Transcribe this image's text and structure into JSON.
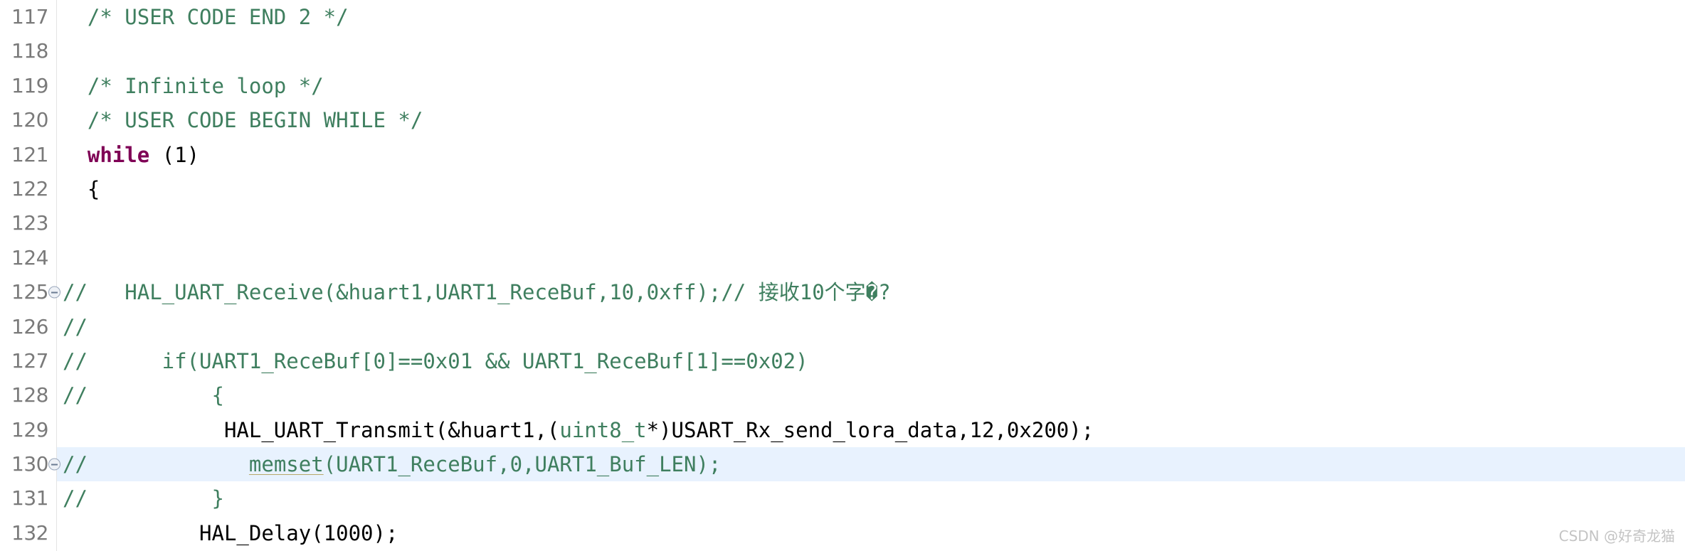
{
  "editor": {
    "app": "c-code-editor",
    "gutter_color": "#7a7a7a",
    "current_line_color": "#e8f2fe",
    "comment_color": "#3f7f5f",
    "keyword_color": "#7f0055",
    "text_color": "#000000",
    "background_color": "#ffffff"
  },
  "watermark": {
    "text": "CSDN @好奇龙猫"
  },
  "lines": [
    {
      "number": "117",
      "fold": false,
      "current": false,
      "tokens": [
        {
          "cls": "cmt",
          "text": "  /* USER CODE END 2 */"
        }
      ]
    },
    {
      "number": "118",
      "fold": false,
      "current": false,
      "tokens": [
        {
          "cls": "plain",
          "text": ""
        }
      ]
    },
    {
      "number": "119",
      "fold": false,
      "current": false,
      "tokens": [
        {
          "cls": "cmt",
          "text": "  /* Infinite loop */"
        }
      ]
    },
    {
      "number": "120",
      "fold": false,
      "current": false,
      "tokens": [
        {
          "cls": "cmt",
          "text": "  /* USER CODE BEGIN WHILE */"
        }
      ]
    },
    {
      "number": "121",
      "fold": false,
      "current": false,
      "tokens": [
        {
          "cls": "plain",
          "text": "  "
        },
        {
          "cls": "kw",
          "text": "while"
        },
        {
          "cls": "plain",
          "text": " (1)"
        }
      ]
    },
    {
      "number": "122",
      "fold": false,
      "current": false,
      "tokens": [
        {
          "cls": "plain",
          "text": "  {"
        }
      ]
    },
    {
      "number": "123",
      "fold": false,
      "current": false,
      "tokens": [
        {
          "cls": "plain",
          "text": ""
        }
      ]
    },
    {
      "number": "124",
      "fold": false,
      "current": false,
      "tokens": [
        {
          "cls": "plain",
          "text": ""
        }
      ]
    },
    {
      "number": "125",
      "fold": true,
      "current": false,
      "tokens": [
        {
          "cls": "cmt",
          "text": "//   HAL_UART_Receive(&huart1,UART1_ReceBuf,10,0xff);// 接收10个字�?"
        }
      ]
    },
    {
      "number": "126",
      "fold": false,
      "current": false,
      "tokens": [
        {
          "cls": "cmt",
          "text": "//"
        }
      ]
    },
    {
      "number": "127",
      "fold": false,
      "current": false,
      "tokens": [
        {
          "cls": "cmt",
          "text": "//      if(UART1_ReceBuf[0]==0x01 && UART1_ReceBuf[1]==0x02)"
        }
      ]
    },
    {
      "number": "128",
      "fold": false,
      "current": false,
      "tokens": [
        {
          "cls": "cmt",
          "text": "//          {"
        }
      ]
    },
    {
      "number": "129",
      "fold": false,
      "current": false,
      "tokens": [
        {
          "cls": "plain",
          "text": "             HAL_UART_Transmit(&huart1,("
        },
        {
          "cls": "typ",
          "text": "uint8_t"
        },
        {
          "cls": "plain",
          "text": "*)USART_Rx_send_lora_data,12,0x200);"
        }
      ]
    },
    {
      "number": "130",
      "fold": true,
      "current": true,
      "tokens": [
        {
          "cls": "cmt",
          "text": "//             "
        },
        {
          "cls": "cmt occ",
          "text": "memset"
        },
        {
          "cls": "cmt",
          "text": "(UART1_ReceBuf,0,UART1_Buf_LEN);"
        }
      ]
    },
    {
      "number": "131",
      "fold": false,
      "current": false,
      "tokens": [
        {
          "cls": "cmt",
          "text": "//          }"
        }
      ]
    },
    {
      "number": "132",
      "fold": false,
      "current": false,
      "tokens": [
        {
          "cls": "plain",
          "text": "           HAL_Delay(1000);"
        }
      ]
    }
  ]
}
